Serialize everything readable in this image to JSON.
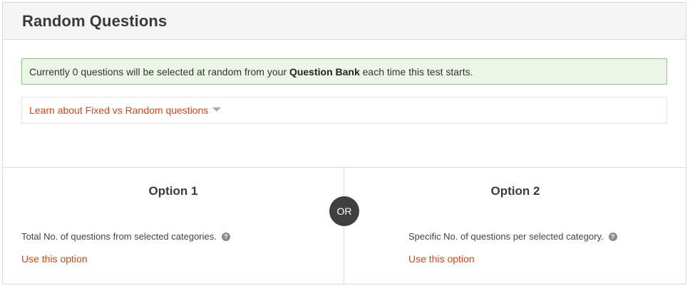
{
  "header": {
    "title": "Random Questions"
  },
  "info": {
    "prefix": "Currently 0 questions will be selected at random from your ",
    "bold": "Question Bank",
    "suffix": " each time this test starts."
  },
  "learn": {
    "label": "Learn about Fixed vs Random questions",
    "icon": "caret-down-icon"
  },
  "options": [
    {
      "title": "Option 1",
      "description": "Total No. of questions from selected categories.",
      "help_icon": "?",
      "link": "Use this option"
    },
    {
      "title": "Option 2",
      "description": "Specific No. of questions per selected category.",
      "help_icon": "?",
      "link": "Use this option"
    }
  ],
  "divider": {
    "label": "OR"
  },
  "colors": {
    "accent_link": "#cc4b1c",
    "info_bg": "#edf5e9",
    "info_border": "#8ec47b",
    "or_badge": "#3f3f3f"
  }
}
